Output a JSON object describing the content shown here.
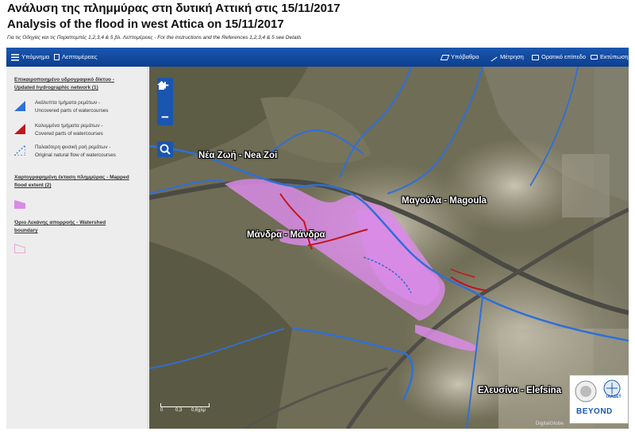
{
  "header": {
    "title_el": "Ανάλυση της πλημμύρας στη δυτική Αττική στις 15/11/2017",
    "title_en": "Analysis of the flood in west Attica on 15/11/2017",
    "subtitle": "Για τις Οδηγίες και τις Παραπομπές 1,2,3,4 & 5 βλ. Λεπτομέρειες - For the Instructions and the References 1,2,3,4 & 5 see Details"
  },
  "toolbar": {
    "legend": "Υπόμνημα",
    "details": "Λεπτομέρειες",
    "basemap": "Υπόβαθρο",
    "measure": "Μέτρηση",
    "fullscreen": "Ορατικό επίπεδο",
    "print": "Εκτύπωση"
  },
  "legend": {
    "section1": {
      "title_el": "Επικαιροποιημένο υδρογραφικό δίκτυο -",
      "title_en": "Updated hydrographic network (1)"
    },
    "items1": [
      {
        "el": "Ακάλυπτα τμήματα ρεμάτων -",
        "en": "Uncovered parts of watercourses",
        "color": "#2f6fd8"
      },
      {
        "el": "Καλυμμένα τμήματα ρεμάτων -",
        "en": "Covered parts of watercourses",
        "color": "#c0161c"
      },
      {
        "el": "Παλαιότερη φυσική ροή ρεμάτων -",
        "en": "Original natural flow of watercourses",
        "color": "#2f6fd8"
      }
    ],
    "section2": {
      "title_el": "Χαρτογραφημένη έκταση πλημμύρας - Mapped",
      "title_en": "flood extent (2)",
      "color": "#d98be6"
    },
    "section3": {
      "title_el": "Όριο Λεκάνης απορροής - Watershed",
      "title_en": "boundary",
      "color": "#e8a9d8"
    }
  },
  "map": {
    "places": {
      "nea_zoi": "Νέα Ζωή - Nea Zoi",
      "magoula": "Μαγούλα - Magoula",
      "mandra": "Μάνδρα - Μάνδρα",
      "elefsina": "Ελευσίνα - Elefsina"
    },
    "scale": {
      "l0": "0",
      "l1": "0,3",
      "l2": "0,6χλμ"
    },
    "credit": "DigitalGlobe",
    "logo": {
      "text": "BEYOND",
      "org": "ΙΑΑΔΕΤ"
    }
  }
}
